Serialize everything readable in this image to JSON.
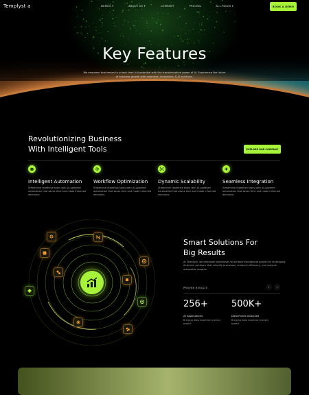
{
  "nav": {
    "brand": "Templyst",
    "brand_mark": "a",
    "links": [
      "DEMOS ▾",
      "ABOUT US ▾",
      "COMPANY",
      "PRICING",
      "ALL PAGES ▾"
    ],
    "cta": "BOOK A DEMO"
  },
  "hero": {
    "title": "Key Features",
    "subtitle": "We empower businesses to unlock their full potential with the transformative power of AI. Experience the future of business growth with seamless, innovative, & AI solutions."
  },
  "features_section": {
    "heading_line1": "Revolutionizing Business",
    "heading_line2": "With Intelligent Tools",
    "cta": "EXPLORE OUR COMPANY",
    "items": [
      {
        "title": "Intelligent Automation",
        "desc": "Streamline repetitive tasks with AI-powered automation that saves time and made informed decisions.",
        "icon": "robot-icon"
      },
      {
        "title": "Workflow Optimization",
        "desc": "Streamline repetitive tasks with AI-powered automation that saves time and made informed decisions.",
        "icon": "gear-icon"
      },
      {
        "title": "Dynamic Scalability",
        "desc": "Streamline repetitive tasks with AI-powered automation that saves time and made informed decisions.",
        "icon": "network-icon"
      },
      {
        "title": "Seamless Integration",
        "desc": "Streamline repetitive tasks with AI-powered automation that saves time and made informed decisions.",
        "icon": "sparkle-icon"
      }
    ]
  },
  "smart_section": {
    "title_line1": "Smart Solutions For",
    "title_line2": "Big Results",
    "desc": "At Templyst, we empower businesses to achieve exceptional growth by leveraging AI-driven solutions that simplify processes, enhance efficiency, and provide actionable insights.",
    "proven_label": "PROVEN RESULTS",
    "prev": "‹",
    "next": "›",
    "stats": [
      {
        "value": "256+",
        "label": "AI Applications",
        "desc": "Bringing deep expertise to every project."
      },
      {
        "value": "500K+",
        "label": "Data Points Analyzed",
        "desc": "Bringing deep expertise to every project."
      }
    ]
  },
  "colors": {
    "accent": "#a6f33a",
    "background": "#000000",
    "badge_orange": "#f0962a"
  }
}
